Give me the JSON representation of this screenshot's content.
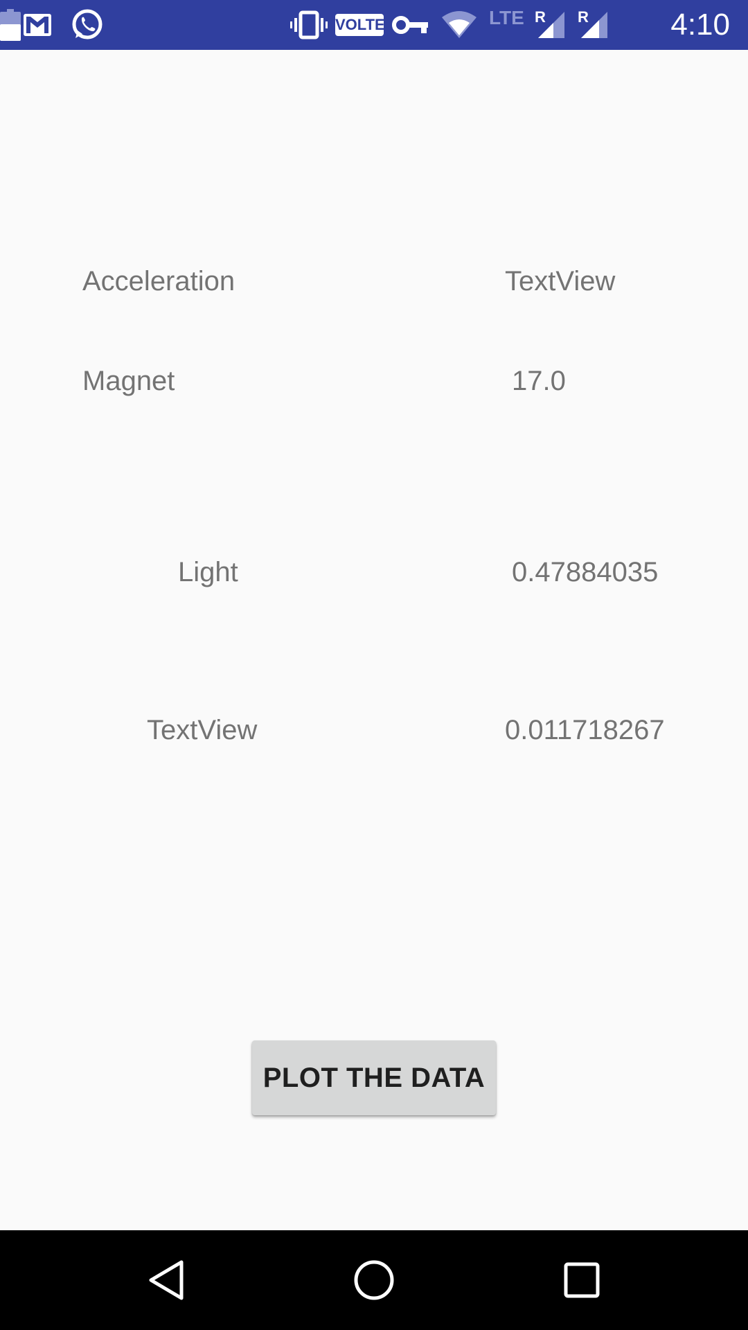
{
  "status_bar": {
    "time": "4:10",
    "volte_label": "VOLTE",
    "network_type": "LTE",
    "roaming_marker_1": "R",
    "roaming_marker_2": "R",
    "icons": [
      "gmail-icon",
      "whatsapp-icon",
      "vibrate-icon",
      "volte-icon",
      "vpn-key-icon",
      "wifi-icon",
      "signal-icon",
      "signal-icon",
      "battery-icon"
    ],
    "background_color": "#303f9f"
  },
  "sensors": {
    "acceleration_label": "Acceleration",
    "acceleration_value": "TextView",
    "magnet_label": "Magnet",
    "magnet_value": "17.0",
    "light_label": "Light",
    "light_value": "0.47884035",
    "extra_label": "TextView",
    "extra_value": "0.011718267"
  },
  "plot_button": {
    "label": "PLOT THE DATA"
  },
  "navigation_bar": {
    "icons": [
      "back-icon",
      "home-icon",
      "recents-icon"
    ]
  }
}
